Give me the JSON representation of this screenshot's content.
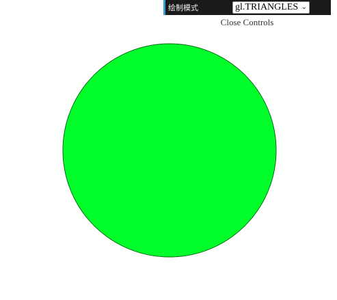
{
  "gui": {
    "draw_mode_label": "绘制模式",
    "draw_mode_value": "gl.TRIANGLES",
    "close_label": "Close Controls"
  },
  "scene": {
    "shape": "circle",
    "fill_color": "#00ff2a",
    "edge_color": "#0a6a14",
    "background_color": "#ffffff"
  }
}
